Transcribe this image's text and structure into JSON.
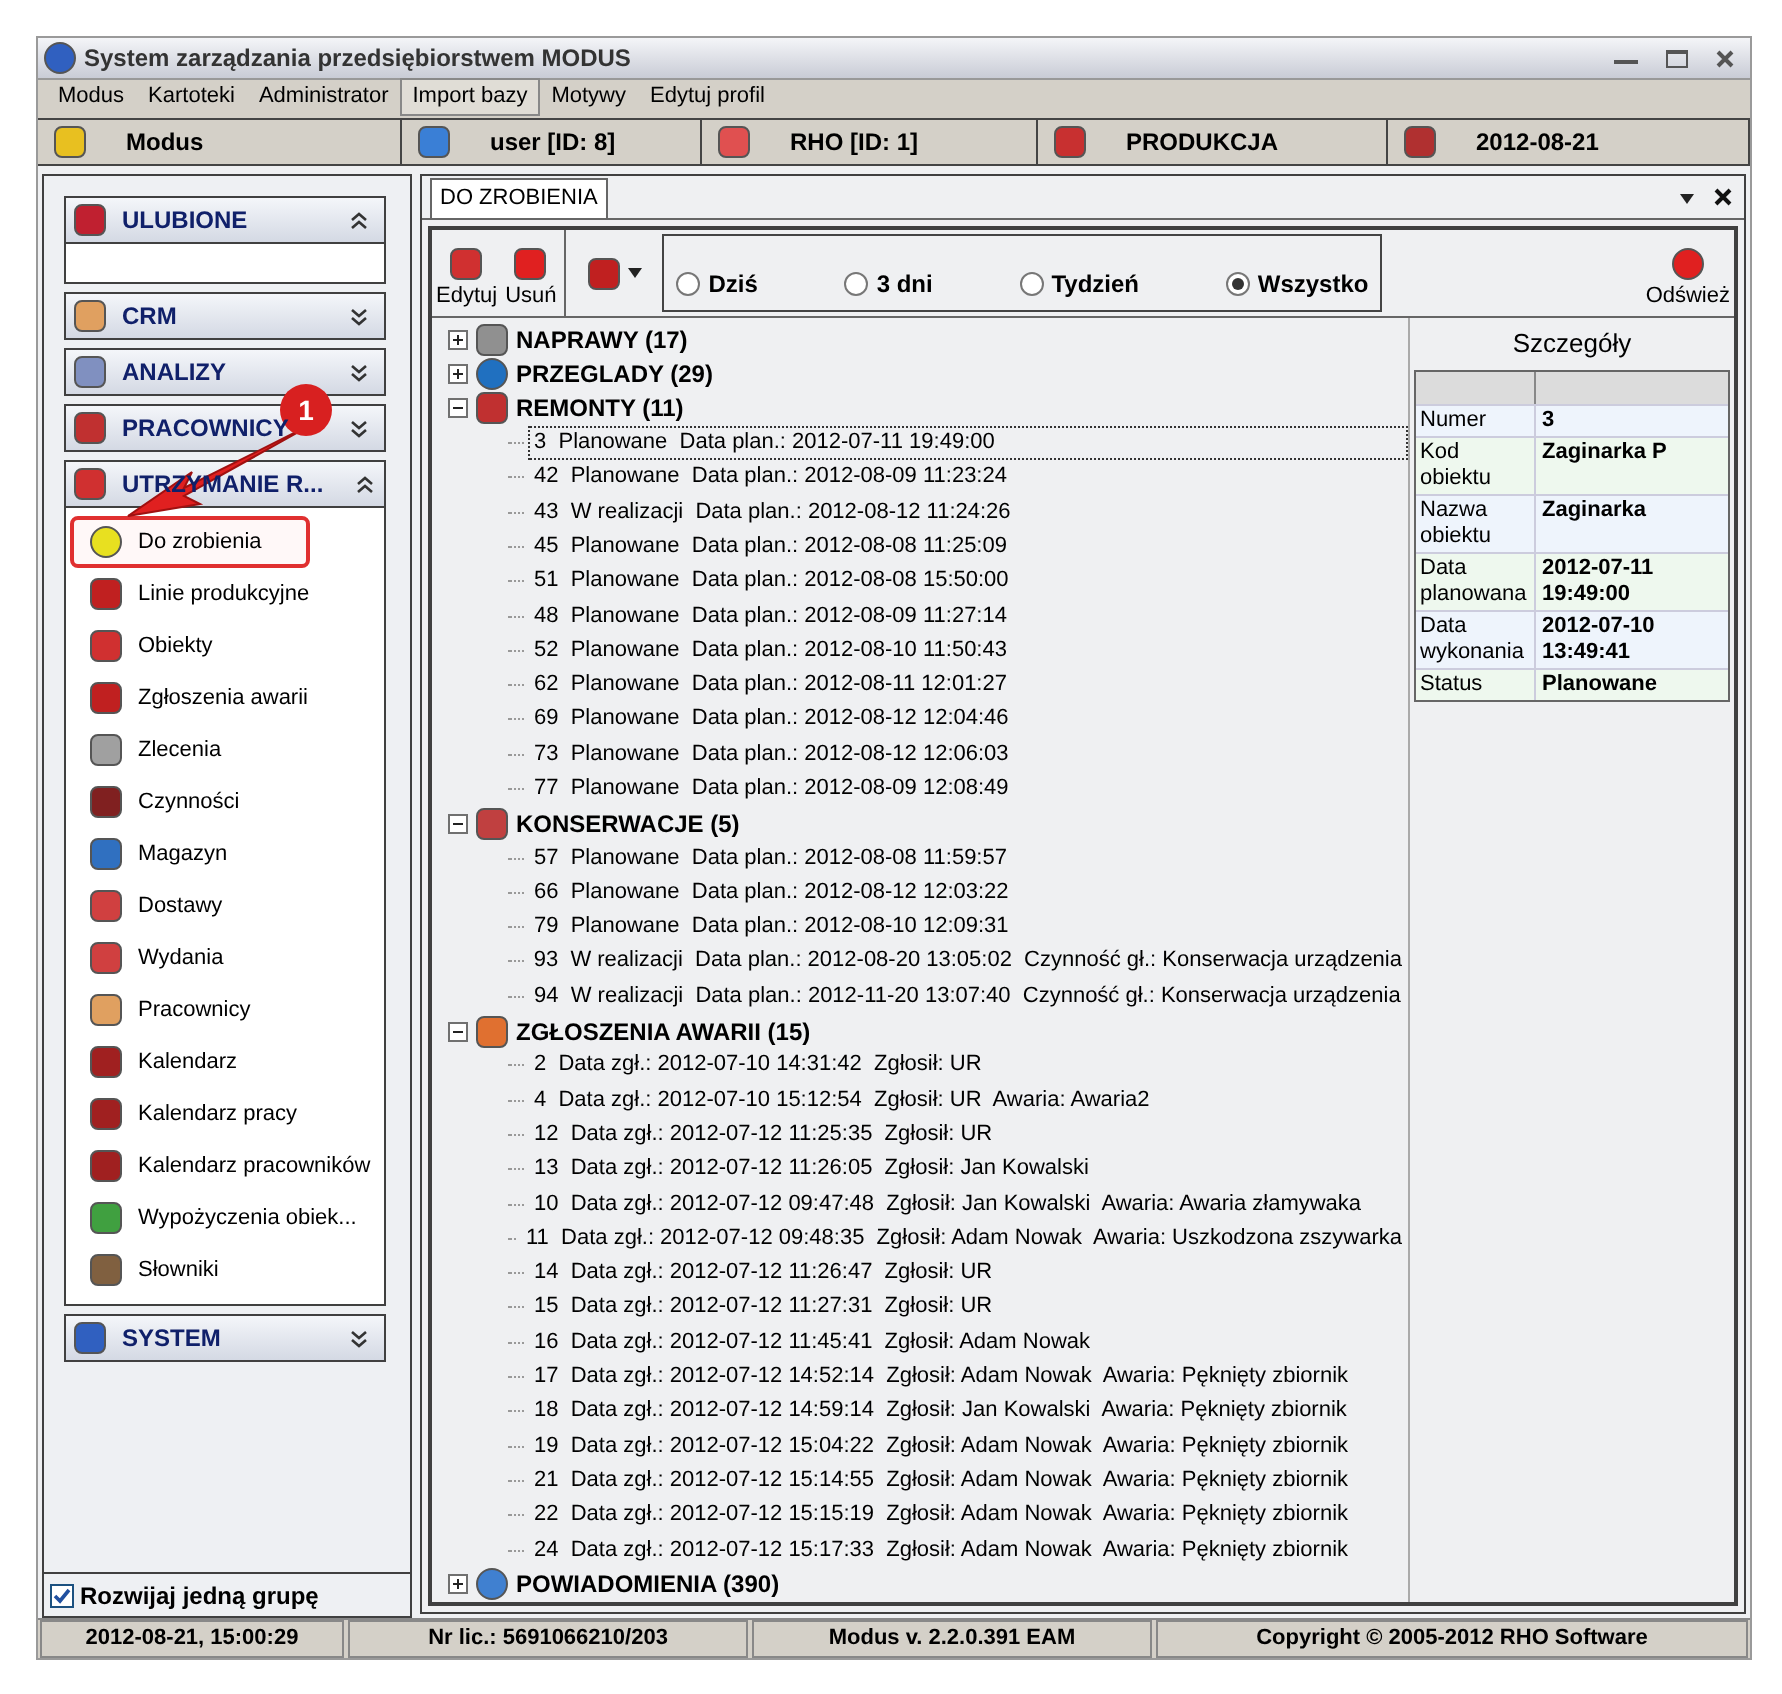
{
  "window": {
    "title": "System zarządzania przedsiębiorstwem MODUS"
  },
  "menu": [
    {
      "label": "Modus",
      "selected": false
    },
    {
      "label": "Kartoteki",
      "selected": false
    },
    {
      "label": "Administrator",
      "selected": false
    },
    {
      "label": "Import bazy",
      "selected": true
    },
    {
      "label": "Motywy",
      "selected": false
    },
    {
      "label": "Edytuj profil",
      "selected": false
    }
  ],
  "info_bar": [
    "Modus",
    "user [ID: 8]",
    "RHO [ID: 1]",
    "PRODUKCJA",
    "2012-08-21"
  ],
  "sidebar": {
    "groups": [
      {
        "title": "ULUBIONE",
        "expanded": true
      },
      {
        "title": "CRM",
        "expanded": false
      },
      {
        "title": "ANALIZY",
        "expanded": false
      },
      {
        "title": "PRACOWNICY",
        "expanded": false
      },
      {
        "title": "UTRZYMANIE R...",
        "expanded": true,
        "items": [
          {
            "label": "Do zrobienia",
            "selected": true
          },
          {
            "label": "Linie produkcyjne",
            "selected": false
          },
          {
            "label": "Obiekty",
            "selected": false
          },
          {
            "label": "Zgłoszenia awarii",
            "selected": false
          },
          {
            "label": "Zlecenia",
            "selected": false
          },
          {
            "label": "Czynności",
            "selected": false
          },
          {
            "label": "Magazyn",
            "selected": false
          },
          {
            "label": "Dostawy",
            "selected": false
          },
          {
            "label": "Wydania",
            "selected": false
          },
          {
            "label": "Pracownicy",
            "selected": false
          },
          {
            "label": "Kalendarz",
            "selected": false
          },
          {
            "label": "Kalendarz pracy",
            "selected": false
          },
          {
            "label": "Kalendarz pracowników",
            "selected": false
          },
          {
            "label": "Wypożyczenia obiek...",
            "selected": false
          },
          {
            "label": "Słowniki",
            "selected": false
          }
        ]
      },
      {
        "title": "SYSTEM",
        "expanded": false
      }
    ],
    "one_group_checkbox": {
      "label": "Rozwijaj jedną grupę",
      "checked": true
    }
  },
  "callout": {
    "badge": "1"
  },
  "tab": {
    "label": "DO ZROBIENIA",
    "selected": true
  },
  "toolbar": {
    "buttons": [
      "Edytuj",
      "Usuń"
    ],
    "filters": [
      {
        "label": "Dziś",
        "selected": false
      },
      {
        "label": "3 dni",
        "selected": false
      },
      {
        "label": "Tydzień",
        "selected": false
      },
      {
        "label": "Wszystko",
        "selected": true
      }
    ],
    "refresh": "Odśwież"
  },
  "tree": [
    {
      "label": "NAPRAWY (17)",
      "expanded": false
    },
    {
      "label": "PRZEGLADY (29)",
      "expanded": false
    },
    {
      "label": "REMONTY (11)",
      "expanded": true,
      "children": [
        {
          "label": "3  Planowane  Data plan.: 2012-07-11 19:49:00",
          "selected": true
        },
        {
          "label": "42  Planowane  Data plan.: 2012-08-09 11:23:24",
          "selected": false
        },
        {
          "label": "43  W realizacji  Data plan.: 2012-08-12 11:24:26",
          "selected": false
        },
        {
          "label": "45  Planowane  Data plan.: 2012-08-08 11:25:09",
          "selected": false
        },
        {
          "label": "51  Planowane  Data plan.: 2012-08-08 15:50:00",
          "selected": false
        },
        {
          "label": "48  Planowane  Data plan.: 2012-08-09 11:27:14",
          "selected": false
        },
        {
          "label": "52  Planowane  Data plan.: 2012-08-10 11:50:43",
          "selected": false
        },
        {
          "label": "62  Planowane  Data plan.: 2012-08-11 12:01:27",
          "selected": false
        },
        {
          "label": "69  Planowane  Data plan.: 2012-08-12 12:04:46",
          "selected": false
        },
        {
          "label": "73  Planowane  Data plan.: 2012-08-12 12:06:03",
          "selected": false
        },
        {
          "label": "77  Planowane  Data plan.: 2012-08-09 12:08:49",
          "selected": false
        }
      ]
    },
    {
      "label": "KONSERWACJE (5)",
      "expanded": true,
      "children": [
        {
          "label": "57  Planowane  Data plan.: 2012-08-08 11:59:57",
          "selected": false
        },
        {
          "label": "66  Planowane  Data plan.: 2012-08-12 12:03:22",
          "selected": false
        },
        {
          "label": "79  Planowane  Data plan.: 2012-08-10 12:09:31",
          "selected": false
        },
        {
          "label": "93  W realizacji  Data plan.: 2012-08-20 13:05:02  Czynność gł.: Konserwacja urządzenia",
          "selected": false
        },
        {
          "label": "94  W realizacji  Data plan.: 2012-11-20 13:07:40  Czynność gł.: Konserwacja urządzenia",
          "selected": false
        }
      ]
    },
    {
      "label": "ZGŁOSZENIA AWARII (15)",
      "expanded": true,
      "children": [
        {
          "label": "2  Data zgł.: 2012-07-10 14:31:42  Zgłosił: UR",
          "selected": false
        },
        {
          "label": "4  Data zgł.: 2012-07-10 15:12:54  Zgłosił: UR  Awaria: Awaria2",
          "selected": false
        },
        {
          "label": "12  Data zgł.: 2012-07-12 11:25:35  Zgłosił: UR",
          "selected": false
        },
        {
          "label": "13  Data zgł.: 2012-07-12 11:26:05  Zgłosił: Jan Kowalski",
          "selected": false
        },
        {
          "label": "10  Data zgł.: 2012-07-12 09:47:48  Zgłosił: Jan Kowalski  Awaria: Awaria złamywaka",
          "selected": false
        },
        {
          "label": "11  Data zgł.: 2012-07-12 09:48:35  Zgłosił: Adam Nowak  Awaria: Uszkodzona zszywarka",
          "selected": false
        },
        {
          "label": "14  Data zgł.: 2012-07-12 11:26:47  Zgłosił: UR",
          "selected": false
        },
        {
          "label": "15  Data zgł.: 2012-07-12 11:27:31  Zgłosił: UR",
          "selected": false
        },
        {
          "label": "16  Data zgł.: 2012-07-12 11:45:41  Zgłosił: Adam Nowak",
          "selected": false
        },
        {
          "label": "17  Data zgł.: 2012-07-12 14:52:14  Zgłosił: Adam Nowak  Awaria: Pęknięty zbiornik",
          "selected": false
        },
        {
          "label": "18  Data zgł.: 2012-07-12 14:59:14  Zgłosił: Jan Kowalski  Awaria: Pęknięty zbiornik",
          "selected": false
        },
        {
          "label": "19  Data zgł.: 2012-07-12 15:04:22  Zgłosił: Adam Nowak  Awaria: Pęknięty zbiornik",
          "selected": false
        },
        {
          "label": "21  Data zgł.: 2012-07-12 15:14:55  Zgłosił: Adam Nowak  Awaria: Pęknięty zbiornik",
          "selected": false
        },
        {
          "label": "22  Data zgł.: 2012-07-12 15:15:19  Zgłosił: Adam Nowak  Awaria: Pęknięty zbiornik",
          "selected": false
        },
        {
          "label": "24  Data zgł.: 2012-07-12 15:17:33  Zgłosił: Adam Nowak  Awaria: Pęknięty zbiornik",
          "selected": false
        }
      ]
    },
    {
      "label": "POWIADOMIENIA (390)",
      "expanded": false
    }
  ],
  "details": {
    "title": "Szczegóły",
    "rows": [
      {
        "label": "Numer",
        "value": "3"
      },
      {
        "label": "Kod obiektu",
        "value": "Zaginarka P"
      },
      {
        "label": "Nazwa obiektu",
        "value": "Zaginarka"
      },
      {
        "label": "Data planowana",
        "value": "2012-07-11 19:49:00"
      },
      {
        "label": "Data wykonania",
        "value": "2012-07-10 13:49:41"
      },
      {
        "label": "Status",
        "value": "Planowane"
      }
    ]
  },
  "status_bar": [
    "2012-08-21, 15:00:29",
    "Nr lic.: 5691066210/203",
    "Modus v. 2.2.0.391 EAM",
    "Copyright © 2005-2012 RHO Software"
  ]
}
